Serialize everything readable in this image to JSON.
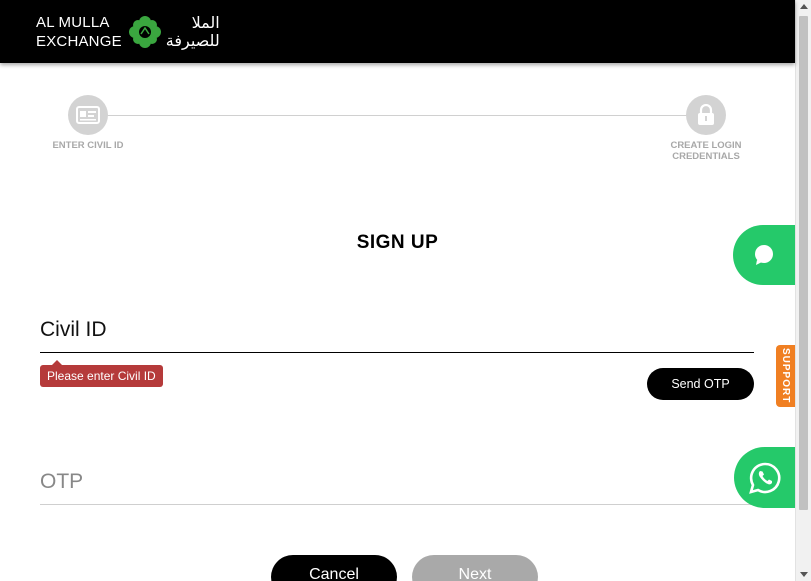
{
  "header": {
    "logo_en_line1": "AL MULLA",
    "logo_en_line2": "EXCHANGE",
    "logo_ar_line1": "الملا",
    "logo_ar_line2": "للصيرفة",
    "background_color": "#000000",
    "logo_mark_color": "#3aa63f"
  },
  "stepper": {
    "steps": [
      {
        "label": "ENTER CIVIL ID",
        "icon": "id-card-icon"
      },
      {
        "label_line1": "CREATE LOGIN",
        "label_line2": "CREDENTIALS",
        "icon": "lock-icon"
      }
    ]
  },
  "form": {
    "title": "SIGN UP",
    "civil_id_label": "Civil ID",
    "civil_id_error": "Please enter Civil ID",
    "send_otp_label": "Send OTP",
    "otp_label": "OTP"
  },
  "actions": {
    "cancel_label": "Cancel",
    "next_label": "Next"
  },
  "floating": {
    "chat_icon": "chat-bubble-icon",
    "support_label": "SUPPORT",
    "whatsapp_icon": "whatsapp-icon",
    "accent_green": "#25c96a",
    "support_color": "#f07f22"
  },
  "colors": {
    "error": "#b53a3a",
    "step_inactive": "#d3d3d3",
    "next_disabled": "#a9a9a9"
  }
}
